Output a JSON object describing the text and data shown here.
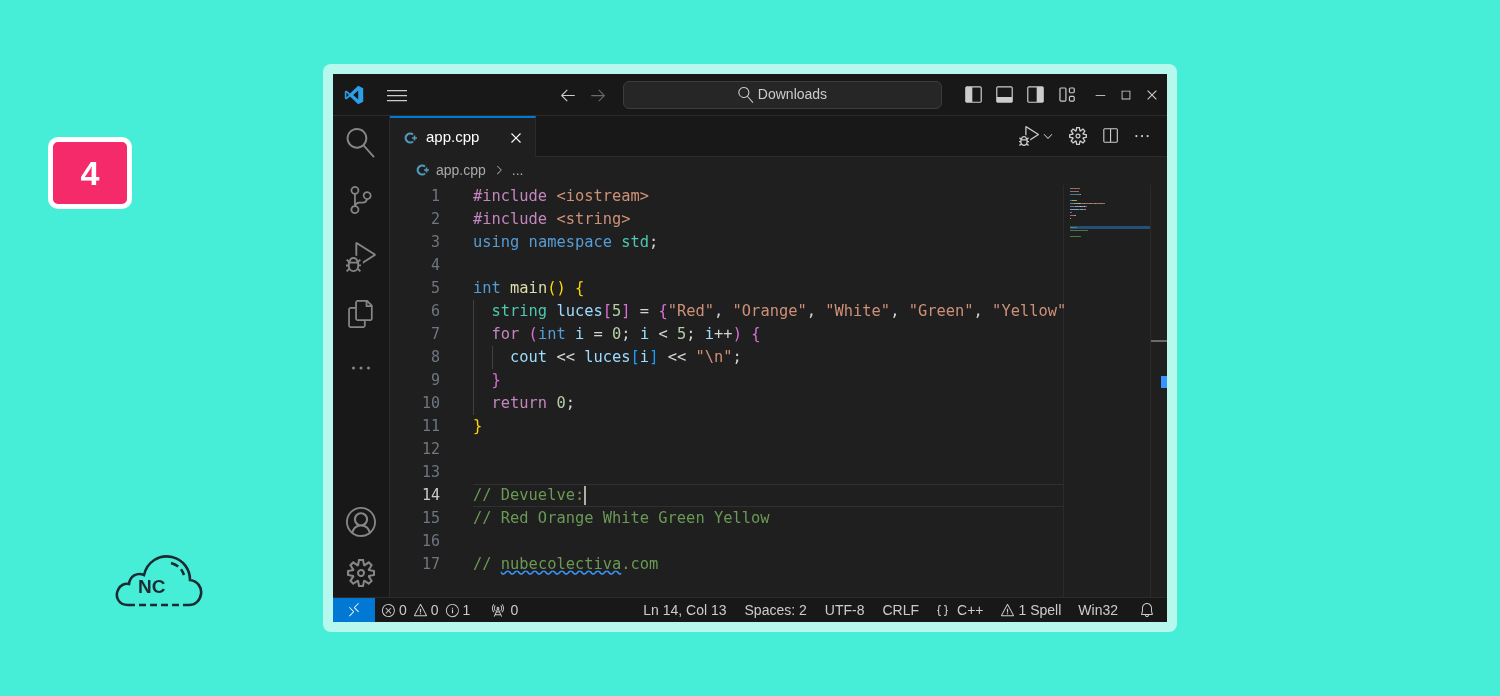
{
  "badge": {
    "text": "4"
  },
  "logo": {
    "text": "NC"
  },
  "title_bar": {
    "search": {
      "text": "Downloads"
    },
    "back_disabled": false,
    "forward_disabled": true
  },
  "tabs": [
    {
      "label": "app.cpp",
      "selected": true
    }
  ],
  "breadcrumb": {
    "file": "app.cpp",
    "more": "..."
  },
  "editor": {
    "lines": [
      {
        "number": "1",
        "selected": false,
        "tokens": [
          {
            "kind": "directive",
            "text": "#include"
          },
          {
            "kind": "string",
            "text": " <iostream>"
          }
        ]
      },
      {
        "number": "2",
        "selected": false,
        "tokens": [
          {
            "kind": "directive",
            "text": "#include"
          },
          {
            "kind": "string",
            "text": " <string>"
          }
        ]
      },
      {
        "number": "3",
        "selected": false,
        "tokens": [
          {
            "kind": "keyword",
            "text": "using"
          },
          {
            "kind": "keyword",
            "text": " namespace"
          },
          {
            "kind": "type",
            "text": " std"
          },
          {
            "kind": "plain",
            "text": ";"
          }
        ]
      },
      {
        "number": "4",
        "selected": false
      },
      {
        "number": "5",
        "selected": false,
        "tokens": [
          {
            "kind": "keyword",
            "text": "int"
          },
          {
            "kind": "function",
            "text": " main"
          },
          {
            "kind": "bracket1",
            "text": "()"
          },
          {
            "kind": "bracket1",
            "text": " {"
          }
        ]
      },
      {
        "number": "6",
        "selected": false,
        "tokens": [
          {
            "kind": "type",
            "text": "  string"
          },
          {
            "kind": "variable",
            "text": " luces"
          },
          {
            "kind": "bracket2",
            "text": "["
          },
          {
            "kind": "number",
            "text": "5"
          },
          {
            "kind": "bracket2",
            "text": "]"
          },
          {
            "kind": "plain",
            "text": " = "
          },
          {
            "kind": "bracket2",
            "text": "{"
          },
          {
            "kind": "string",
            "text": "\"Red\""
          },
          {
            "kind": "plain",
            "text": ", "
          },
          {
            "kind": "string",
            "text": "\"Orange\""
          },
          {
            "kind": "plain",
            "text": ", "
          },
          {
            "kind": "string",
            "text": "\"White\""
          },
          {
            "kind": "plain",
            "text": ", "
          },
          {
            "kind": "string",
            "text": "\"Green\""
          },
          {
            "kind": "plain",
            "text": ", "
          },
          {
            "kind": "string",
            "text": "\"Yellow\""
          }
        ]
      },
      {
        "number": "7",
        "selected": false,
        "tokens": [
          {
            "kind": "control",
            "text": "  for"
          },
          {
            "kind": "bracket2",
            "text": " ("
          },
          {
            "kind": "keyword",
            "text": "int"
          },
          {
            "kind": "variable",
            "text": " i"
          },
          {
            "kind": "plain",
            "text": " = "
          },
          {
            "kind": "number",
            "text": "0"
          },
          {
            "kind": "plain",
            "text": "; "
          },
          {
            "kind": "variable",
            "text": "i"
          },
          {
            "kind": "plain",
            "text": " < "
          },
          {
            "kind": "number",
            "text": "5"
          },
          {
            "kind": "plain",
            "text": "; "
          },
          {
            "kind": "variable",
            "text": "i"
          },
          {
            "kind": "plain",
            "text": "++"
          },
          {
            "kind": "bracket2",
            "text": ")"
          },
          {
            "kind": "bracket2",
            "text": " {"
          }
        ]
      },
      {
        "number": "8",
        "selected": false,
        "tokens": [
          {
            "kind": "variable",
            "text": "    cout"
          },
          {
            "kind": "plain",
            "text": " << "
          },
          {
            "kind": "variable",
            "text": "luces"
          },
          {
            "kind": "bracket3",
            "text": "["
          },
          {
            "kind": "variable",
            "text": "i"
          },
          {
            "kind": "bracket3",
            "text": "]"
          },
          {
            "kind": "plain",
            "text": " << "
          },
          {
            "kind": "string",
            "text": "\"\\n\""
          },
          {
            "kind": "plain",
            "text": ";"
          }
        ]
      },
      {
        "number": "9",
        "selected": false,
        "tokens": [
          {
            "kind": "bracket2",
            "text": "  }"
          }
        ]
      },
      {
        "number": "10",
        "selected": false,
        "tokens": [
          {
            "kind": "control",
            "text": "  return"
          },
          {
            "kind": "number",
            "text": " 0"
          },
          {
            "kind": "plain",
            "text": ";"
          }
        ]
      },
      {
        "number": "11",
        "selected": false,
        "tokens": [
          {
            "kind": "bracket1",
            "text": "}"
          }
        ]
      },
      {
        "number": "12",
        "selected": false
      },
      {
        "number": "13",
        "selected": false
      },
      {
        "number": "14",
        "selected": true,
        "tokens": [
          {
            "kind": "comment",
            "text": "// Devuelve:"
          }
        ]
      },
      {
        "number": "15",
        "selected": false,
        "tokens": [
          {
            "kind": "comment",
            "text": "// Red Orange White Green Yellow"
          }
        ]
      },
      {
        "number": "16",
        "selected": false
      },
      {
        "number": "17",
        "selected": false,
        "tokens": [
          {
            "kind": "comment",
            "text": "// "
          },
          {
            "kind": "misspelled",
            "text": "nubecolectiva"
          },
          {
            "kind": "comment",
            "text": ".com"
          }
        ]
      }
    ]
  },
  "status_bar": {
    "left": [
      {
        "kind": "problems",
        "errors": "0",
        "warnings": "0",
        "infos": "1"
      },
      {
        "kind": "ports",
        "text": "0"
      }
    ],
    "right": [
      {
        "kind": "text",
        "text": "Ln 14, Col 13"
      },
      {
        "kind": "text",
        "text": "Spaces: 2"
      },
      {
        "kind": "text",
        "text": "UTF-8"
      },
      {
        "kind": "text",
        "text": "CRLF"
      },
      {
        "kind": "language",
        "text": "C++"
      },
      {
        "kind": "spell",
        "text": "1 Spell"
      },
      {
        "kind": "text",
        "text": "Win32"
      }
    ]
  }
}
